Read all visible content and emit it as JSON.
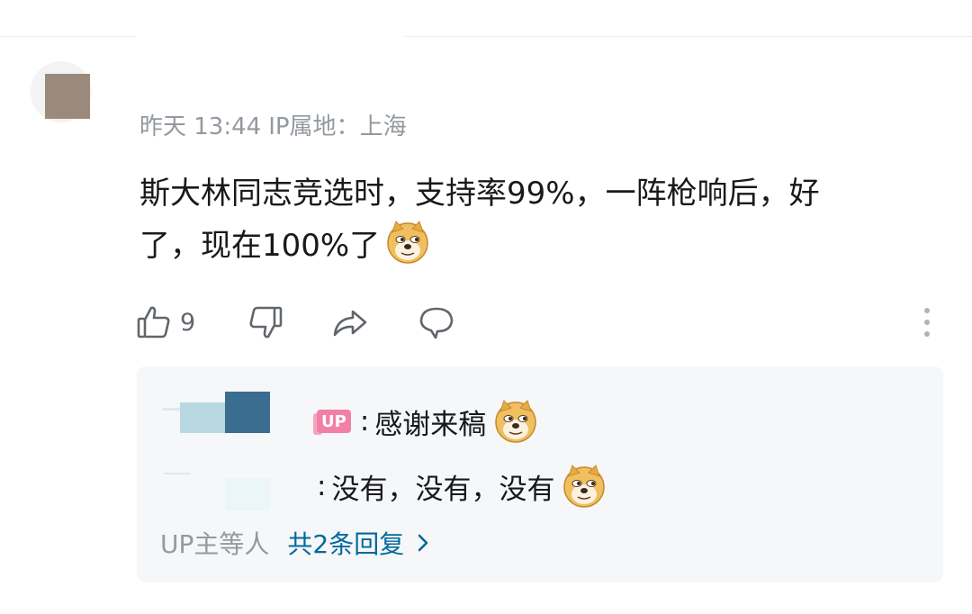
{
  "comment": {
    "meta": {
      "time": "昨天 13:44",
      "ip_label": "IP属地：",
      "ip_location": "上海"
    },
    "text_line1": "斯大林同志竞选时，支持率99%，一阵枪响后，好",
    "text_line2": "了，现在100%了",
    "emoji": "doge-emoji",
    "actions": {
      "like_count": "9",
      "icons": [
        "thumb-up-icon",
        "thumb-down-icon",
        "share-icon",
        "comment-icon",
        "more-icon"
      ]
    }
  },
  "replies": {
    "items": [
      {
        "badge": "UP",
        "separator": ":",
        "text": "感谢来稿",
        "emoji": "doge-emoji"
      },
      {
        "separator": ":",
        "text": "没有，没有，没有",
        "emoji": "doge-emoji"
      }
    ],
    "summary_prefix": "UP主等人",
    "summary_count": "共2条回复"
  },
  "colors": {
    "meta_gray": "#9499a0",
    "link_blue": "#00699d",
    "up_badge_pink": "#f27fa5",
    "reply_bg": "#f6f7f8"
  }
}
